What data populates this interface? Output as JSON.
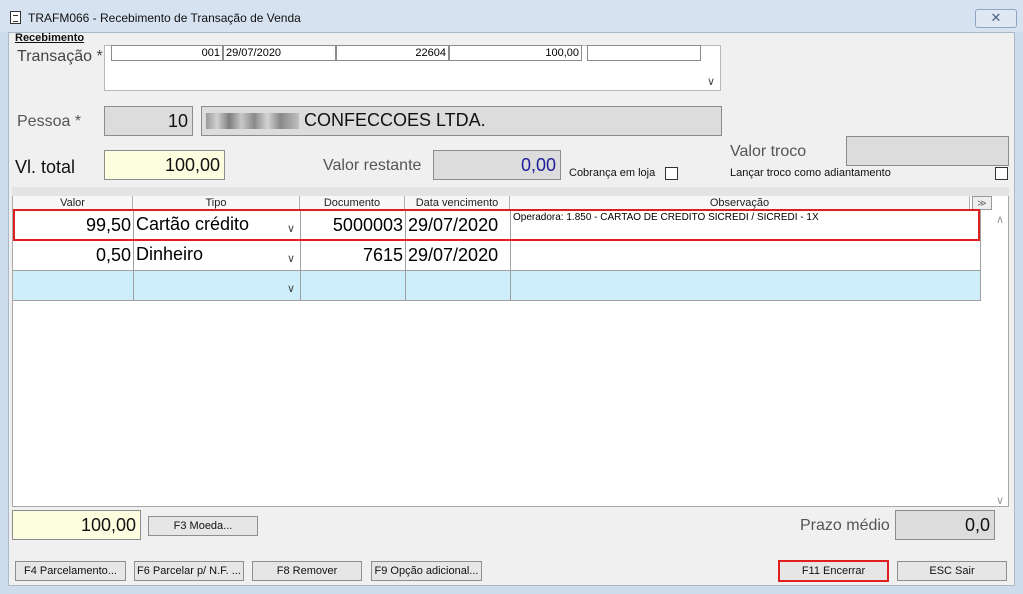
{
  "window": {
    "title": "TRAFM066 - Recebimento de Transação de Venda",
    "close_symbol": "✕"
  },
  "section": {
    "title": "Recebimento"
  },
  "transacao": {
    "label": "Transação *",
    "codigo": "001",
    "data": "29/07/2020",
    "numero": "22604",
    "valor": "100,00",
    "extra": ""
  },
  "pessoa": {
    "label": "Pessoa *",
    "codigo": "10",
    "nome": "CONFECCOES LTDA."
  },
  "totais": {
    "vl_total_label": "Vl. total",
    "vl_total": "100,00",
    "valor_restante_label": "Valor restante",
    "valor_restante": "0,00",
    "cobranca_label": "Cobrança em loja",
    "valor_troco_label": "Valor troco",
    "valor_troco": "",
    "lancar_troco_label": "Lançar troco como adiantamento"
  },
  "grid": {
    "headers": [
      "Valor",
      "Tipo",
      "Documento",
      "Data vencimento",
      "Observação"
    ],
    "rows": [
      {
        "valor": "99,50",
        "tipo": "Cartão crédito",
        "documento": "5000003",
        "data": "29/07/2020",
        "observacao": "Operadora: 1.850 - CARTAO DE CREDITO SICREDI / SICREDI - 1X"
      },
      {
        "valor": "0,50",
        "tipo": "Dinheiro",
        "documento": "7615",
        "data": "29/07/2020",
        "observacao": ""
      },
      {
        "valor": "",
        "tipo": "",
        "documento": "",
        "data": "",
        "observacao": ""
      }
    ]
  },
  "footer": {
    "total": "100,00",
    "moeda_button": "F3 Moeda...",
    "prazo_medio_label": "Prazo médio",
    "prazo_medio": "0,0"
  },
  "actions": {
    "parcelamento": "F4 Parcelamento...",
    "parcelar_nf": "F6 Parcelar p/ N.F. ...",
    "remover": "F8 Remover",
    "opcao_adicional": "F9 Opção adicional...",
    "encerrar": "F11 Encerrar",
    "sair": "ESC Sair"
  },
  "colors": {
    "highlight": "#e02020",
    "new_row": "#cdeefa",
    "yellow_field": "#fdfde0",
    "blue_value": "#1c1c99"
  }
}
